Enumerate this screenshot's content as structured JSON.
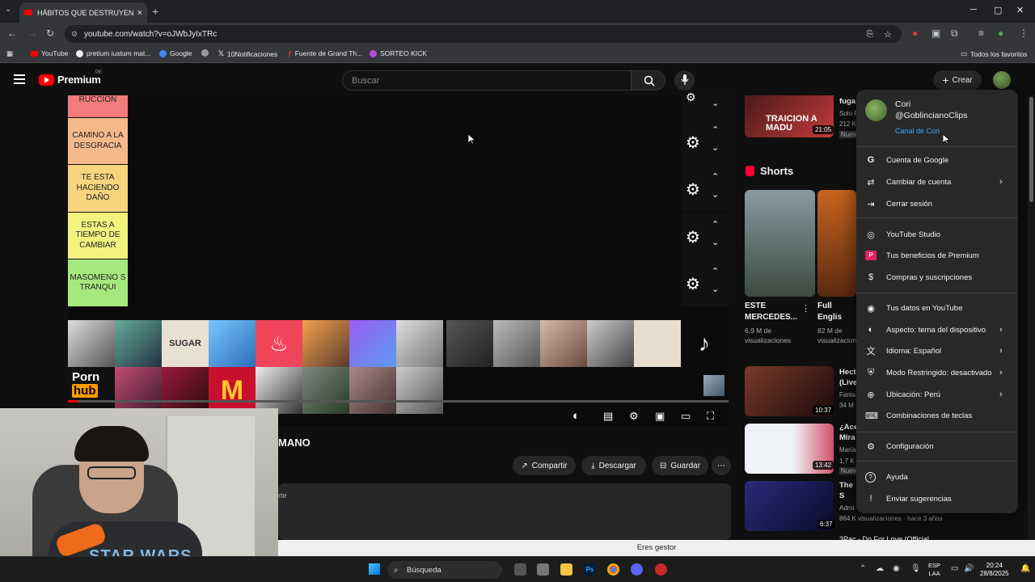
{
  "browser": {
    "tab_title": "HÁBITOS QUE DESTRUYEN A TU",
    "url": "youtube.com/watch?v=oJWbJyIxTRc",
    "bookmarks": [
      "YouTube",
      "pretium iustum mat...",
      "Google",
      "10Notificaciones",
      "Fuente de Grand Th...",
      "SORTEO KICK"
    ],
    "all_bookmarks": "Todos los favoritos",
    "new_tab": "+",
    "close": "×",
    "minimize": "─",
    "maximize": "▢",
    "close_window": "✕"
  },
  "youtube": {
    "logo_text": "Premium",
    "country": "PE",
    "search_placeholder": "Buscar",
    "create_label": "Crear"
  },
  "tiers": [
    {
      "label": "RUCCION",
      "color": "#f27c7c"
    },
    {
      "label": "CAMINO A LA DESGRACIA",
      "color": "#f6b98a"
    },
    {
      "label": "TE ESTA HACIENDO DAÑO",
      "color": "#f7d47e"
    },
    {
      "label": "ESTAS A TIEMPO DE CAMBIAR",
      "color": "#f3f27f"
    },
    {
      "label": "MASOMENO S TRANQUI",
      "color": "#a6e87d"
    }
  ],
  "thumbs_text": {
    "sugar": "SUGAR",
    "porn": "Porn",
    "hub": "hub"
  },
  "video": {
    "title": "MANO",
    "description_fragment": "rte"
  },
  "actions": {
    "share": "Compartir",
    "download": "Descargar",
    "save": "Guardar",
    "more": "⋯"
  },
  "sidebar": {
    "top_item": {
      "title": "fuga",
      "channel": "Solo F",
      "views": "212 K",
      "badge": "Nuev",
      "duration": "21:05",
      "thumb_text": "TRAICION A MADU"
    },
    "shorts_label": "Shorts",
    "shorts": [
      {
        "title": "ESTE MERCEDES...",
        "views": "6,9 M de visualizaciones"
      },
      {
        "title": "Full Englis Breakfast",
        "views": "82 M de visualizaciones"
      }
    ],
    "items": [
      {
        "title": "Hecto (Live",
        "channel": "Fania",
        "views": "34 M",
        "duration": "10:37"
      },
      {
        "title": "¿Ace Mira",
        "channel": "María",
        "views": "1,7 K v",
        "badge": "Nuev",
        "duration": "13:42"
      },
      {
        "title": "The S (mell",
        "channel": "Admi",
        "views": "864 K visualizaciones · hace 3 años",
        "duration": "6:37"
      }
    ],
    "partial_bottom": "3Pac - Do For Love (Official"
  },
  "account_menu": {
    "name": "Cori",
    "handle": "@GoblincianoClips",
    "channel_link": "Canal de Cori",
    "groups": [
      [
        {
          "label": "Cuenta de Google",
          "icon": "google-icon",
          "glyph": "G",
          "chevron": false
        },
        {
          "label": "Cambiar de cuenta",
          "icon": "switch-account-icon",
          "glyph": "⇄",
          "chevron": true
        },
        {
          "label": "Cerrar sesión",
          "icon": "sign-out-icon",
          "glyph": "⇥",
          "chevron": false
        }
      ],
      [
        {
          "label": "YouTube Studio",
          "icon": "studio-icon",
          "glyph": "◎",
          "chevron": false
        },
        {
          "label": "Tus beneficios de Premium",
          "icon": "premium-icon",
          "glyph": "P",
          "chevron": false
        },
        {
          "label": "Compras y suscripciones",
          "icon": "purchases-icon",
          "glyph": "$",
          "chevron": false
        }
      ],
      [
        {
          "label": "Tus datos en YouTube",
          "icon": "your-data-icon",
          "glyph": "◉",
          "chevron": false
        },
        {
          "label": "Aspecto: tema del dispositivo",
          "icon": "appearance-icon",
          "glyph": "◐",
          "chevron": true
        },
        {
          "label": "Idioma: Español",
          "icon": "language-icon",
          "glyph": "文",
          "chevron": true
        },
        {
          "label": "Modo Restringido: desactivado",
          "icon": "restricted-mode-icon",
          "glyph": "⛨",
          "chevron": true
        },
        {
          "label": "Ubicación: Perú",
          "icon": "location-icon",
          "glyph": "⊕",
          "chevron": true
        },
        {
          "label": "Combinaciones de teclas",
          "icon": "keyboard-icon",
          "glyph": "⌨",
          "chevron": false
        }
      ],
      [
        {
          "label": "Configuración",
          "icon": "settings-icon",
          "glyph": "⚙",
          "chevron": false
        }
      ],
      [
        {
          "label": "Ayuda",
          "icon": "help-icon",
          "glyph": "?",
          "chevron": false
        },
        {
          "label": "Enviar sugerencias",
          "icon": "feedback-icon",
          "glyph": "!",
          "chevron": false
        }
      ]
    ]
  },
  "webcam": {
    "shirt_text": "STAR WARS"
  },
  "toast": "Eres gestor",
  "taskbar": {
    "search_label": "Búsqueda",
    "lang_top": "ESP",
    "lang_bottom": "LAA",
    "time": "20:24",
    "date": "28/8/2025"
  }
}
